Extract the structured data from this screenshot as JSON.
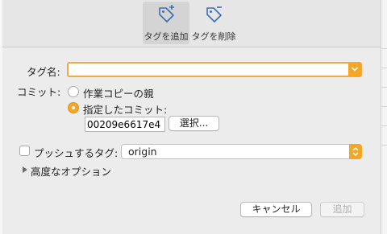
{
  "toolbar": {
    "add_tag_label": "タグを追加",
    "remove_tag_label": "タグを削除"
  },
  "form": {
    "tag_name_label": "タグ名:",
    "tag_name_value": "",
    "commit_label": "コミット:",
    "radio_working_copy_label": "作業コピーの親",
    "radio_specified_commit_label": "指定したコミット:",
    "selected_commit_option": "指定したコミット",
    "commit_hash_value": "00209e6617e4",
    "select_button_label": "選択...",
    "push_tag_label": "プッシュするタグ:",
    "push_tag_checked": false,
    "remote_value": "origin",
    "advanced_options_label": "高度なオプション"
  },
  "footer": {
    "cancel_label": "キャンセル",
    "add_label": "追加",
    "add_enabled": false
  },
  "colors": {
    "accent": "#f5a623",
    "focus_ring": "#f0a94a",
    "toolbar_icon": "#3d6fb6"
  },
  "icons": [
    "tag-add-icon",
    "tag-remove-icon",
    "chevron-down-icon",
    "updown-arrows-icon",
    "disclosure-triangle-icon"
  ]
}
